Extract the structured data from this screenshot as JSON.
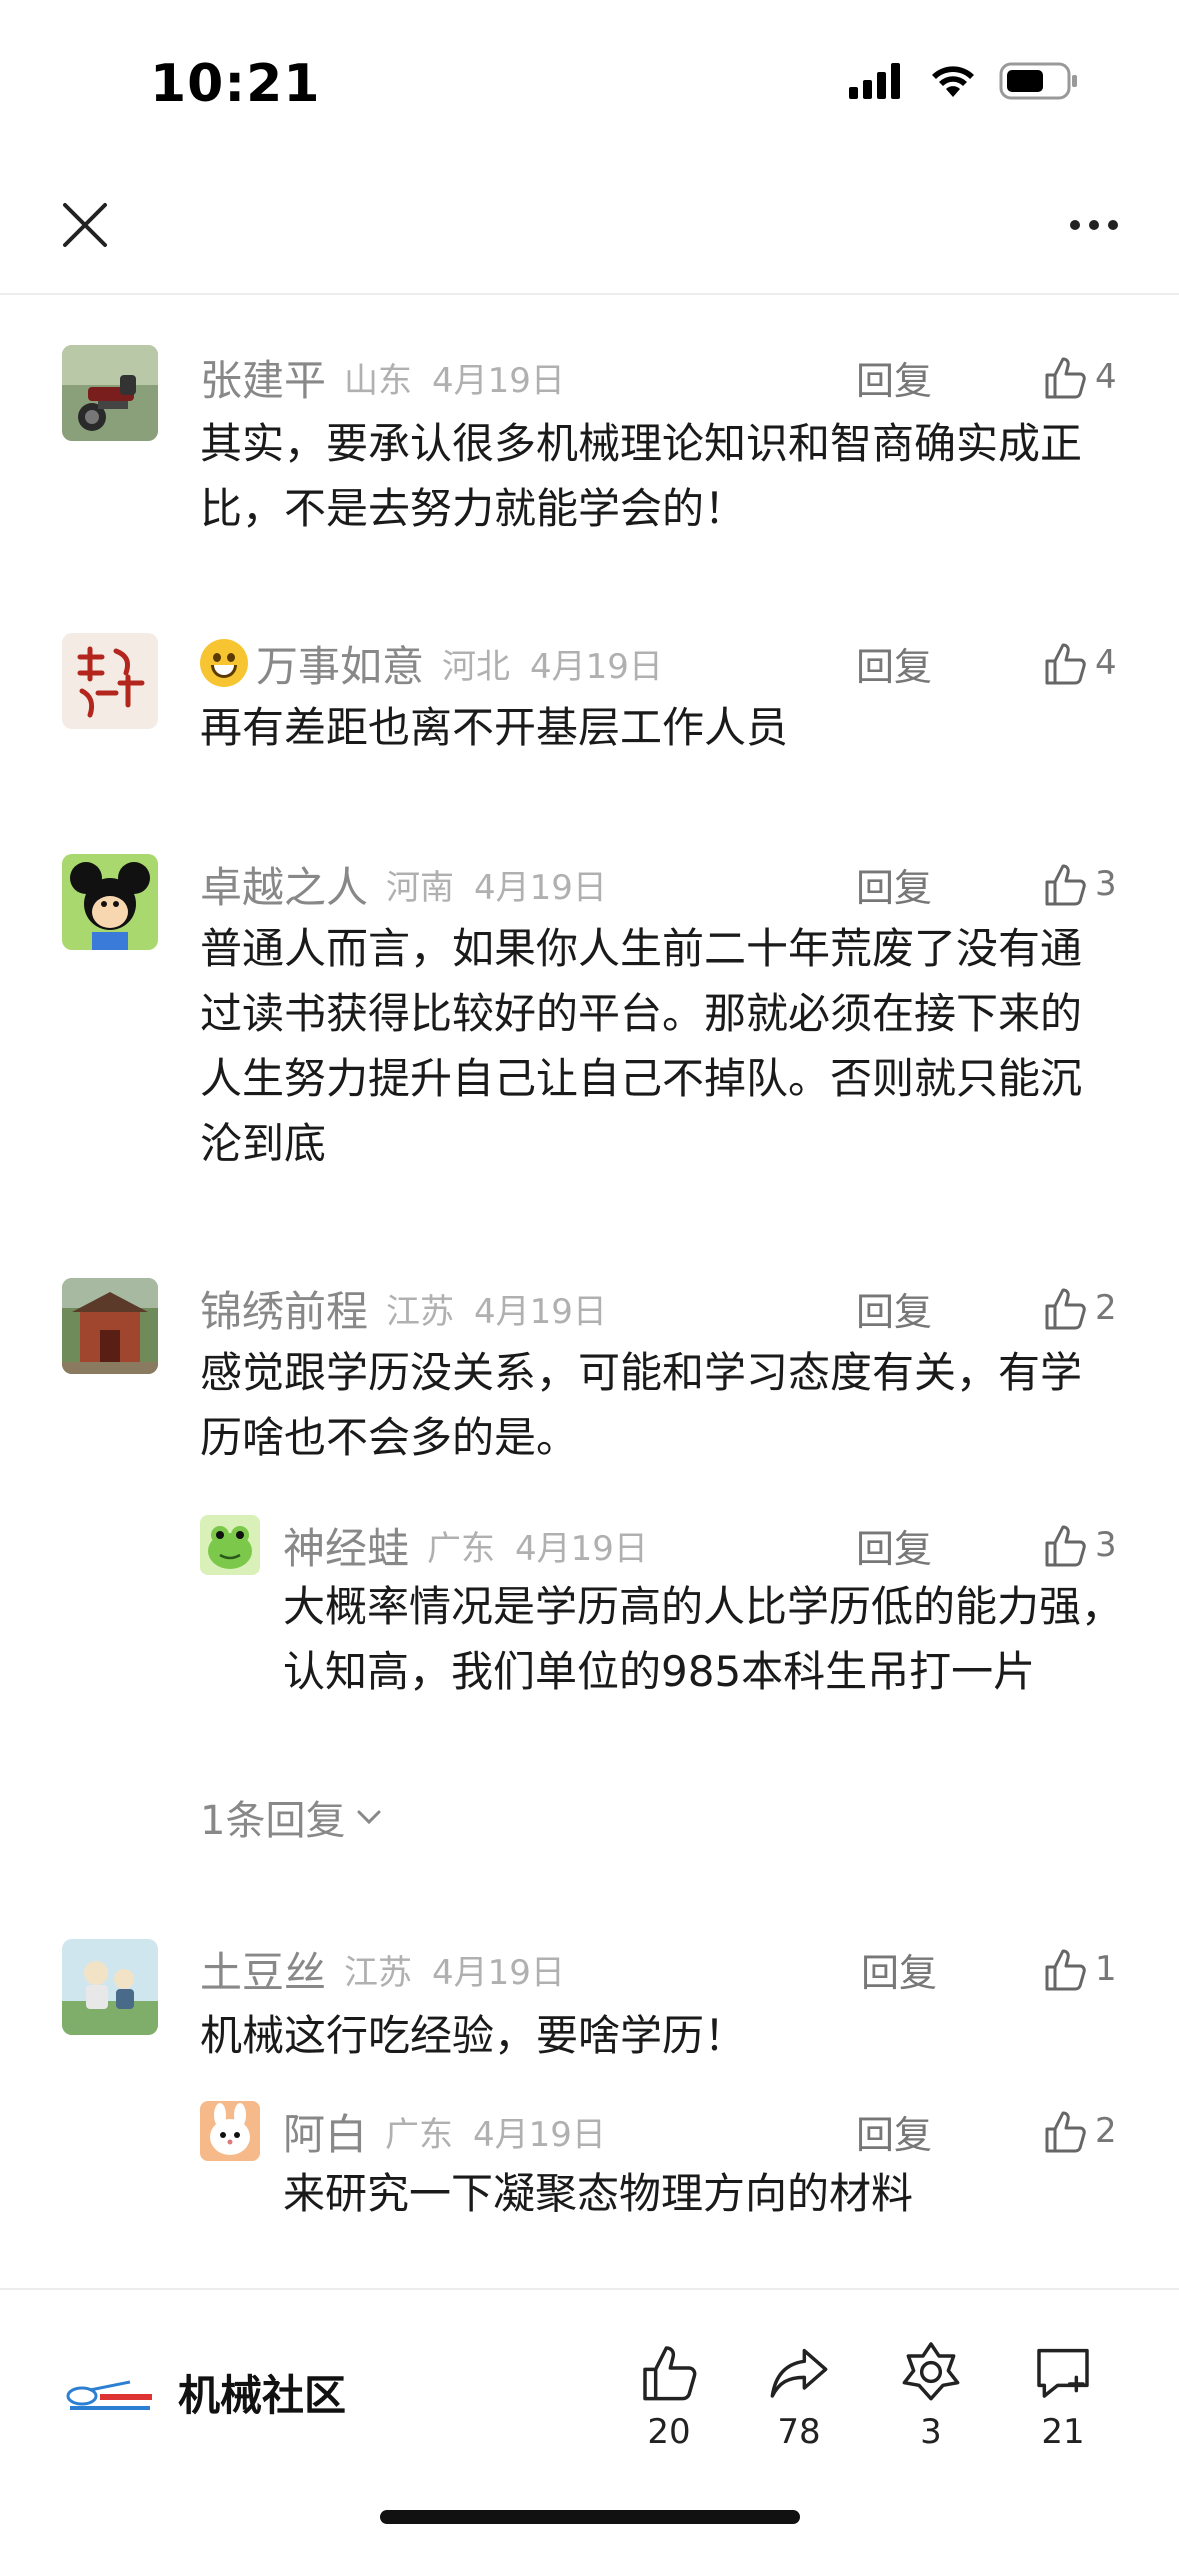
{
  "status": {
    "time": "10:21"
  },
  "comments": [
    {
      "name": "张建平",
      "location": "山东",
      "date": "4月19日",
      "reply": "回复",
      "likes": "4",
      "text": "其实，要承认很多机械理论知识和智商确实成正比，不是去努力就能学会的！"
    },
    {
      "name": "万事如意",
      "location": "河北",
      "date": "4月19日",
      "reply": "回复",
      "likes": "4",
      "text": "再有差距也离不开基层工作人员"
    },
    {
      "name": "卓越之人",
      "location": "河南",
      "date": "4月19日",
      "reply": "回复",
      "likes": "3",
      "text": "普通人而言，如果你人生前二十年荒废了没有通过读书获得比较好的平台。那就必须在接下来的人生努力提升自己让自己不掉队。否则就只能沉沦到底"
    },
    {
      "name": "锦绣前程",
      "location": "江苏",
      "date": "4月19日",
      "reply": "回复",
      "likes": "2",
      "text": "感觉跟学历没关系，可能和学习态度有关，有学历啥也不会多的是。",
      "sub": {
        "name": "神经蛙",
        "location": "广东",
        "date": "4月19日",
        "reply": "回复",
        "likes": "3",
        "text": "大概率情况是学历高的人比学历低的能力强，认知高，我们单位的985本科生吊打一片"
      },
      "more_replies": "1条回复"
    },
    {
      "name": "土豆丝",
      "location": "江苏",
      "date": "4月19日",
      "reply": "回复",
      "likes": "1",
      "text": "机械这行吃经验，要啥学历！",
      "sub": {
        "name": "阿白",
        "location": "广东",
        "date": "4月19日",
        "reply": "回复",
        "likes": "2",
        "text": "来研究一下凝聚态物理方向的材料"
      }
    }
  ],
  "bottom": {
    "brand_name": "机械社区",
    "likes": "20",
    "shares": "78",
    "favorites": "3",
    "comments": "21"
  }
}
